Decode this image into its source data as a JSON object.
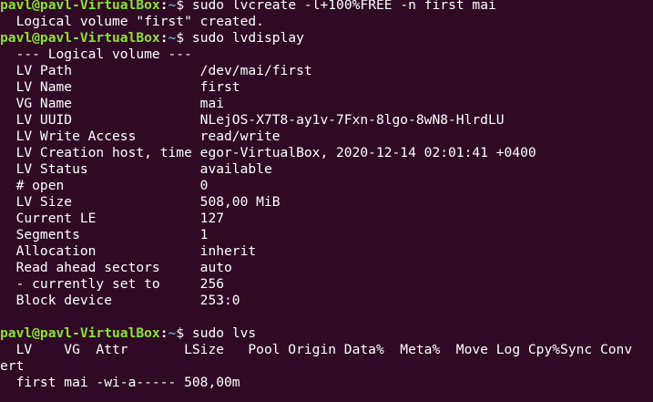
{
  "colors": {
    "background": "#300a24",
    "prompt_user": "#8ae234",
    "prompt_path": "#729fcf",
    "text": "#ffffff"
  },
  "prompt": {
    "user_host": "pavl@pavl-VirtualBox",
    "separator": ":",
    "path": "~",
    "symbol": "$ "
  },
  "blocks": [
    {
      "command": "sudo lvcreate -l+100%FREE -n first mai",
      "output": [
        "  Logical volume \"first\" created."
      ]
    },
    {
      "command": "sudo lvdisplay",
      "output": [
        "  --- Logical volume ---",
        "  LV Path                /dev/mai/first",
        "  LV Name                first",
        "  VG Name                mai",
        "  LV UUID                NLejOS-X7T8-ay1v-7Fxn-8lgo-8wN8-HlrdLU",
        "  LV Write Access        read/write",
        "  LV Creation host, time egor-VirtualBox, 2020-12-14 02:01:41 +0400",
        "  LV Status              available",
        "  # open                 0",
        "  LV Size                508,00 MiB",
        "  Current LE             127",
        "  Segments               1",
        "  Allocation             inherit",
        "  Read ahead sectors     auto",
        "  - currently set to     256",
        "  Block device           253:0",
        ""
      ]
    },
    {
      "command": "sudo lvs",
      "output": [
        "  LV    VG  Attr       LSize   Pool Origin Data%  Meta%  Move Log Cpy%Sync Conv",
        "ert",
        "  first mai -wi-a----- 508,00m"
      ]
    }
  ]
}
